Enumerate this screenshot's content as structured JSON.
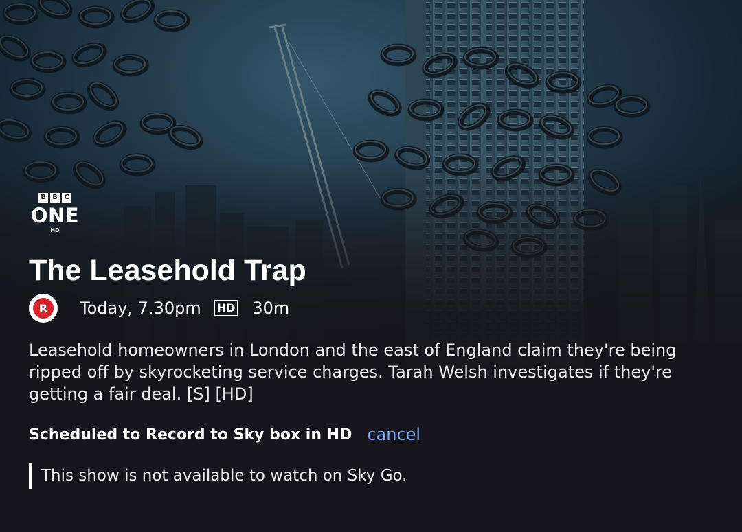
{
  "channel": {
    "logo_blocks": [
      "B",
      "B",
      "C"
    ],
    "name": "ONE",
    "quality": "HD"
  },
  "programme": {
    "title": "The Leasehold Trap",
    "record_icon_letter": "R",
    "time": "Today, 7.30pm",
    "format_badge": "HD",
    "duration": "30m",
    "synopsis": "Leasehold homeowners in London and the east of England claim they're being ripped off by skyrocketing service charges. Tarah Welsh investigates if they're getting a fair deal. [S] [HD]"
  },
  "recording": {
    "status": "Scheduled to Record to Sky box in HD",
    "cancel_label": "cancel"
  },
  "notice": {
    "text": "This show is not available to watch on Sky Go."
  },
  "colors": {
    "background": "#17161c",
    "record_red": "#d8232a",
    "link_blue": "#7aa7ef"
  }
}
